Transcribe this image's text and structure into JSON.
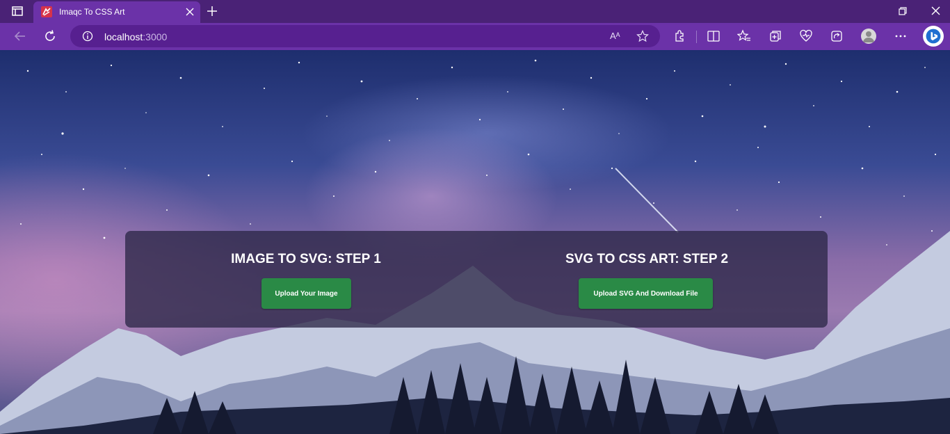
{
  "browser": {
    "tab": {
      "title": "Imaqc To CSS Art"
    },
    "address": {
      "host": "localhost",
      "port": ":3000"
    },
    "readaloud_glyph": "Aᴬ"
  },
  "main": {
    "step1": {
      "heading": "IMAGE TO SVG: STEP 1",
      "button": "Upload Your Image"
    },
    "step2": {
      "heading": "SVG TO CSS ART: STEP 2",
      "button": "Upload SVG And Download File"
    }
  },
  "colors": {
    "titlebar": "#4a2276",
    "toolbar": "#6b32a8",
    "button": "#2a8a46",
    "panel": "rgba(45,40,72,0.78)"
  }
}
